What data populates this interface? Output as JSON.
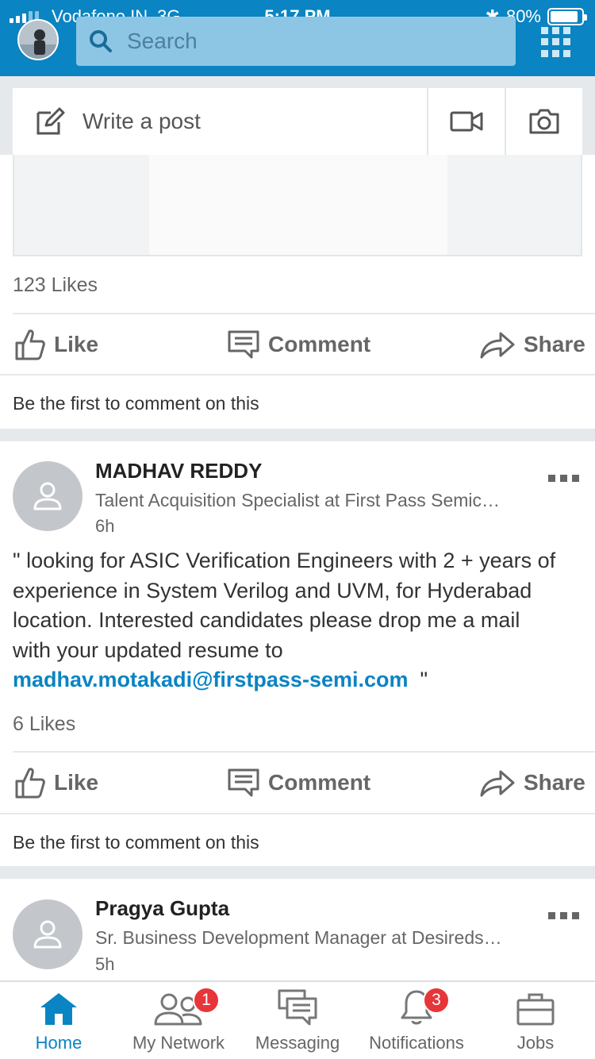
{
  "status_bar": {
    "carrier": "Vodafone IN",
    "network": "3G",
    "time": "5:17 PM",
    "battery": "80%"
  },
  "search": {
    "placeholder": "Search"
  },
  "composer": {
    "label": "Write a post"
  },
  "feed": [
    {
      "likes": "123 Likes",
      "actions": {
        "like": "Like",
        "comment": "Comment",
        "share": "Share"
      },
      "first_comment": "Be the first to comment on this"
    },
    {
      "author": "MADHAV REDDY",
      "headline": "Talent Acquisition Specialist at First Pass Semic…",
      "age": "6h",
      "body_line1": "\" looking for ASIC Verification Engineers with 2 + years of",
      "body_line2": "experience in System Verilog and UVM, for Hyderabad",
      "body_line3": "location. Interested candidates please drop me a mail",
      "body_line4": "with your updated resume to",
      "body_link": "madhav.motakadi@firstpass-semi.com",
      "body_end": "\"",
      "likes": "6 Likes",
      "actions": {
        "like": "Like",
        "comment": "Comment",
        "share": "Share"
      },
      "first_comment": "Be the first to comment on this"
    },
    {
      "author": "Pragya Gupta",
      "headline": "Sr. Business Development Manager at Desireds…",
      "age": "5h"
    }
  ],
  "bottom_nav": {
    "home": "Home",
    "network": "My Network",
    "network_badge": "1",
    "messaging": "Messaging",
    "notifications": "Notifications",
    "notifications_badge": "3",
    "jobs": "Jobs"
  },
  "colors": {
    "brand": "#0a84c2",
    "badge": "#e7363a"
  }
}
